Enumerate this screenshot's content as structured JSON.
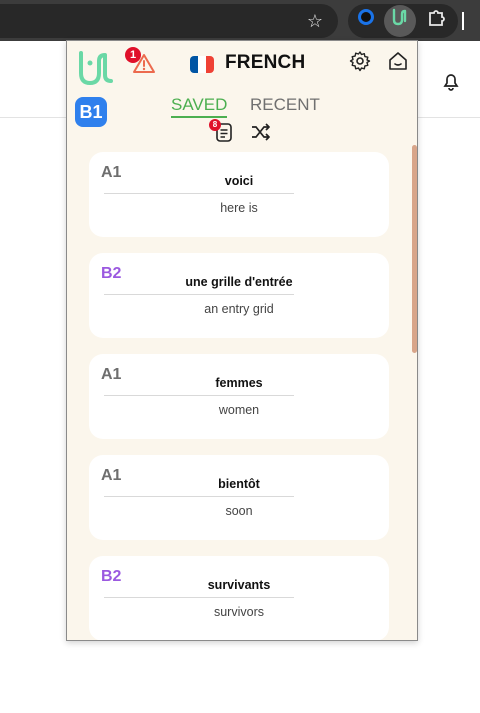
{
  "browser": {
    "star_icon": "star-icon",
    "extensions": [
      "circle-extension-icon",
      "lingo-extension-icon",
      "puzzle-extension-icon"
    ]
  },
  "popup": {
    "alert_count": "1",
    "language": "FRENCH",
    "level": "B1",
    "tabs": [
      {
        "label": "SAVED",
        "active": true
      },
      {
        "label": "RECENT",
        "active": false
      }
    ],
    "list_badge_count": "8",
    "cards": [
      {
        "level": "A1",
        "word": "voici",
        "translation": "here is"
      },
      {
        "level": "B2",
        "word": "une grille d'entrée",
        "translation": "an entry grid"
      },
      {
        "level": "A1",
        "word": "femmes",
        "translation": "women"
      },
      {
        "level": "A1",
        "word": "bientôt",
        "translation": "soon"
      },
      {
        "level": "B2",
        "word": "survivants",
        "translation": "survivors"
      }
    ]
  },
  "colors": {
    "accent_green": "#4caf50",
    "level_badge_blue": "#2f80ed",
    "alert_red": "#e0102a",
    "level_b_purple": "#9b59e0",
    "popup_bg": "#fbf6ec"
  }
}
